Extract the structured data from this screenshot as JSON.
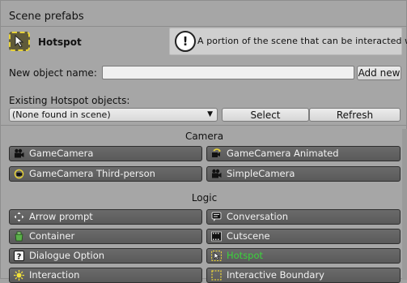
{
  "title": "Scene prefabs",
  "current": {
    "name": "Hotspot",
    "icon": "hotspot-icon",
    "icon_color": "#e7d23a"
  },
  "help": {
    "icon": "exclamation-icon",
    "text": "A portion of the scene that can be interacted with."
  },
  "new_object": {
    "label": "New object name:",
    "value": "",
    "add_label": "Add new"
  },
  "existing": {
    "label": "Existing Hotspot objects:",
    "selected": "(None found in scene)",
    "select_label": "Select",
    "refresh_label": "Refresh"
  },
  "sections": {
    "camera": {
      "header": "Camera",
      "items": [
        {
          "label": "GameCamera",
          "icon": "movie-camera-icon"
        },
        {
          "label": "GameCamera Animated",
          "icon": "animated-camera-icon"
        },
        {
          "label": "GameCamera Third-person",
          "icon": "third-person-camera-icon"
        },
        {
          "label": "SimpleCamera",
          "icon": "movie-camera-icon"
        }
      ]
    },
    "logic": {
      "header": "Logic",
      "items": [
        {
          "label": "Arrow prompt",
          "icon": "arrow-prompt-icon"
        },
        {
          "label": "Conversation",
          "icon": "speech-bubble-icon"
        },
        {
          "label": "Container",
          "icon": "container-icon"
        },
        {
          "label": "Cutscene",
          "icon": "film-strip-icon"
        },
        {
          "label": "Dialogue Option",
          "icon": "question-icon"
        },
        {
          "label": "Hotspot",
          "icon": "hotspot-icon",
          "highlight_color": "#3bd43b"
        },
        {
          "label": "Interaction",
          "icon": "sun-icon"
        },
        {
          "label": "Interactive Boundary",
          "icon": "boundary-icon"
        }
      ]
    }
  }
}
